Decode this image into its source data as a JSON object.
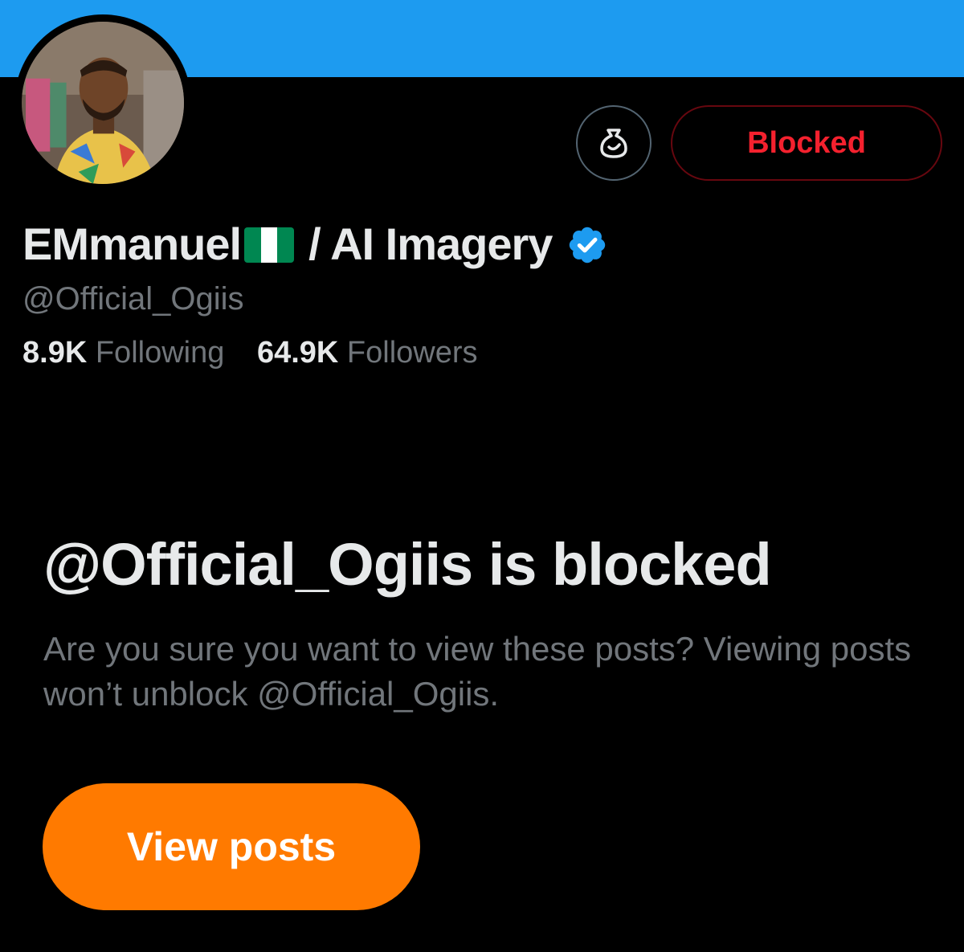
{
  "profile": {
    "name_part1": "EMmanuel",
    "flag_emoji_name": "nigeria-flag-icon",
    "name_part2": "/ AI Imagery",
    "handle": "@Official_Ogiis",
    "following_count": "8.9K",
    "following_label": "Following",
    "followers_count": "64.9K",
    "followers_label": "Followers",
    "verified_icon": "verified-badge-icon",
    "avatar_icon": "profile-avatar"
  },
  "actions": {
    "grok_icon": "grok-icon",
    "blocked_label": "Blocked"
  },
  "blocked_notice": {
    "title": "@Official_Ogiis is blocked",
    "message": "Are you sure you want to view these posts? Viewing posts won’t unblock @Official_Ogiis.",
    "button_label": "View posts"
  },
  "colors": {
    "banner": "#1d9bf0",
    "blocked_red": "#f4212e",
    "muted_text": "#71767b",
    "button_orange": "#ff7a00",
    "verified_blue": "#1d9bf0"
  }
}
